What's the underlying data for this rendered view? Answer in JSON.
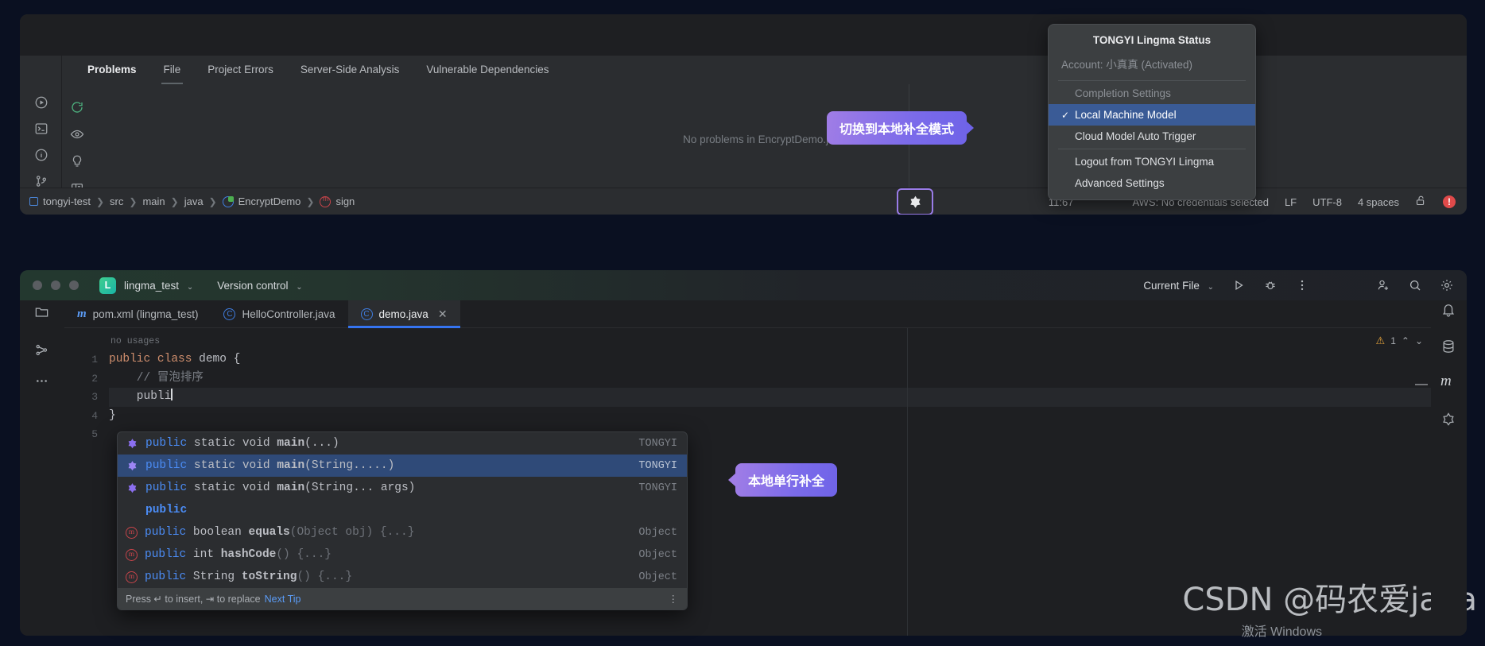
{
  "problems_window": {
    "tabs": [
      {
        "label": "Problems",
        "active": true
      },
      {
        "label": "File",
        "active": false,
        "underlined": true
      },
      {
        "label": "Project Errors",
        "active": false
      },
      {
        "label": "Server-Side Analysis",
        "active": false
      },
      {
        "label": "Vulnerable Dependencies",
        "active": false
      }
    ],
    "empty_message": "No problems in EncryptDemo.java",
    "rail_icons": [
      "run-icon",
      "terminal-icon",
      "info-circle-icon",
      "vcs-branch-icon"
    ],
    "toolbar_icons": [
      "refresh-icon",
      "eye-icon",
      "lightbulb-icon",
      "split-view-icon"
    ],
    "breadcrumb": [
      {
        "label": "tongyi-test",
        "icon": "module-icon"
      },
      {
        "label": "src",
        "icon": ""
      },
      {
        "label": "main",
        "icon": ""
      },
      {
        "label": "java",
        "icon": ""
      },
      {
        "label": "EncryptDemo",
        "icon": "class-icon"
      },
      {
        "label": "sign",
        "icon": "method-icon"
      }
    ],
    "status": {
      "caret_position": "11:67",
      "aws": "AWS: No credentials selected",
      "line_separator": "LF",
      "encoding": "UTF-8",
      "indent": "4 spaces",
      "lock_icon": "unlocked-icon",
      "error_badge": "!",
      "lingma_icon": "tongyi-lingma-icon"
    }
  },
  "lingma_menu": {
    "title": "TONGYI Lingma Status",
    "account": "Account: 小真真 (Activated)",
    "section_label": "Completion Settings",
    "items": [
      {
        "label": "Local Machine Model",
        "selected": true,
        "check": "✓"
      },
      {
        "label": "Cloud Model Auto Trigger",
        "selected": false,
        "check": ""
      }
    ],
    "footer_items": [
      {
        "label": "Logout from TONGYI Lingma"
      },
      {
        "label": "Advanced Settings"
      }
    ]
  },
  "callouts": {
    "local_mode": "切换到本地补全模式",
    "inline_completion": "本地单行补全"
  },
  "ide": {
    "titlebar": {
      "project": "lingma_test",
      "project_badge": "L",
      "version_control": "Version control",
      "run_config": "Current File",
      "icons": [
        "run-icon",
        "debug-icon",
        "more-vertical-icon",
        "add-user-icon",
        "search-icon",
        "settings-gear-icon"
      ],
      "chevron": "⌄"
    },
    "tabs": [
      {
        "label": "pom.xml (lingma_test)",
        "icon": "maven-icon",
        "active": false,
        "closable": false
      },
      {
        "label": "HelloController.java",
        "icon": "java-class-icon",
        "active": false,
        "closable": false
      },
      {
        "label": "demo.java",
        "icon": "java-class-icon",
        "active": true,
        "closable": true,
        "close": "✕"
      }
    ],
    "tab_overflow_icon": "more-vertical-icon",
    "left_rail_icons": [
      "project-folder-icon",
      "structure-icon",
      "more-dots-icon"
    ],
    "right_rail_icons": [
      "notifications-bell-icon",
      "database-icon",
      "maven-m-icon",
      "lingma-icon"
    ],
    "editor": {
      "usage_hint": "no usages",
      "warning_count": "1",
      "warning_icon": "warning-triangle-icon",
      "nav_up": "⌃",
      "nav_down": "⌄",
      "lines": [
        {
          "number": "1",
          "tokens": [
            {
              "t": "public ",
              "c": "kw"
            },
            {
              "t": "class ",
              "c": "kw"
            },
            {
              "t": "demo {",
              "c": "cls"
            }
          ]
        },
        {
          "number": "2",
          "tokens": [
            {
              "t": "    // 冒泡排序",
              "c": "cmt"
            }
          ]
        },
        {
          "number": "3",
          "tokens": [
            {
              "t": "    publi",
              "c": "plain"
            }
          ],
          "caret": true,
          "highlight": true
        },
        {
          "number": "4",
          "tokens": [
            {
              "t": "}",
              "c": "plain"
            }
          ]
        },
        {
          "number": "5",
          "tokens": [
            {
              "t": "",
              "c": "plain"
            }
          ]
        }
      ]
    }
  },
  "completion_popup": {
    "rows": [
      {
        "icon": "tongyi-ai-icon",
        "mod": "public ",
        "ret": "static void ",
        "name": "main",
        "args": "(...)",
        "source": "TONGYI",
        "selected": false
      },
      {
        "icon": "tongyi-ai-icon",
        "mod": "public ",
        "ret": "static void ",
        "name": "main",
        "args": "(String.....)",
        "source": "TONGYI",
        "selected": true
      },
      {
        "icon": "tongyi-ai-icon",
        "mod": "public ",
        "ret": "static void ",
        "name": "main",
        "args": "(String... args)",
        "source": "TONGYI",
        "selected": false
      },
      {
        "icon": "none",
        "mod": "public",
        "ret": "",
        "name": "",
        "args": "",
        "source": "",
        "selected": false
      },
      {
        "icon": "method-icon",
        "mod": "public ",
        "ret": "boolean ",
        "name": "equals",
        "args": "(Object obj) {...}",
        "source": "Object",
        "selected": false
      },
      {
        "icon": "method-icon",
        "mod": "public ",
        "ret": "int ",
        "name": "hashCode",
        "args": "() {...}",
        "source": "Object",
        "selected": false
      },
      {
        "icon": "method-icon",
        "mod": "public ",
        "ret": "String ",
        "name": "toString",
        "args": "() {...}",
        "source": "Object",
        "selected": false
      }
    ],
    "footer": {
      "text_before": "Press ↵ to insert, ⇥ to replace",
      "link": "Next Tip",
      "menu_icon": "more-vertical-icon"
    }
  },
  "watermarks": {
    "csdn": "CSDN @码农爱java",
    "windows": "激活 Windows"
  },
  "colors": {
    "accent_blue": "#3574f0",
    "selection_blue": "#2f4a78",
    "menu_selection": "#3a5b96",
    "callout_purple": "#7b6bea",
    "error_red": "#e04a4a",
    "keyword_orange": "#cf8e6d"
  }
}
